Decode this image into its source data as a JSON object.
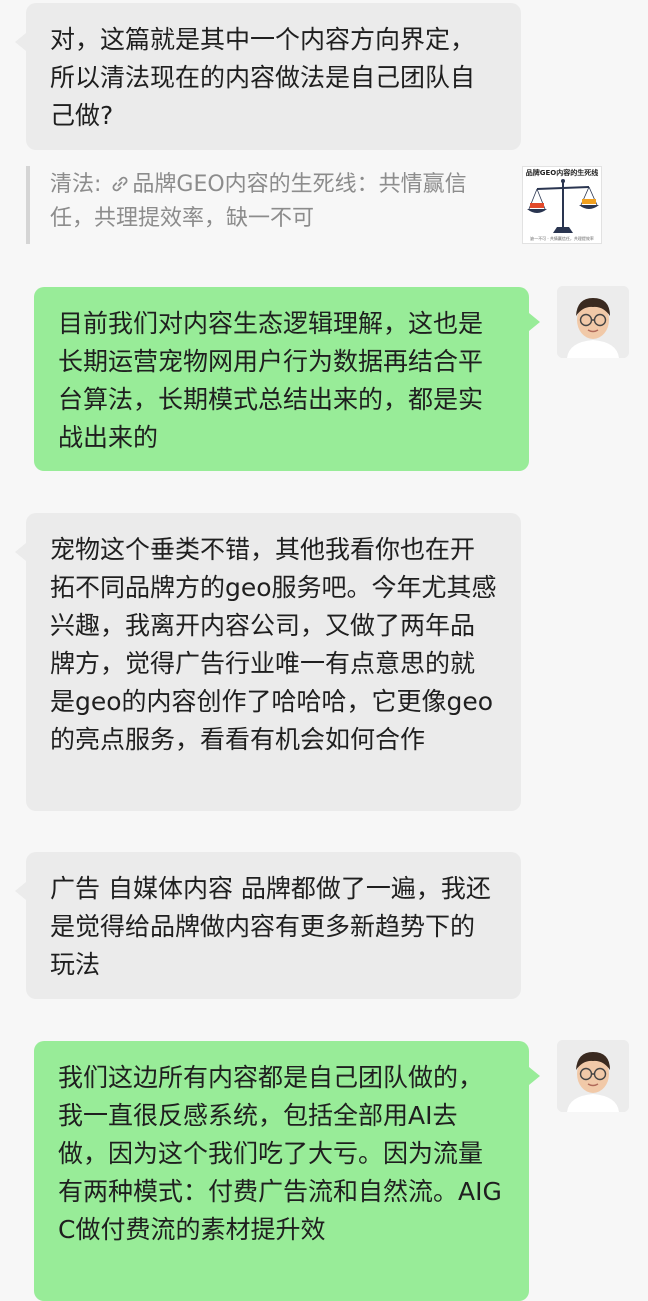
{
  "messages": [
    {
      "text": "对，这篇就是其中一个内容方向界定，所以清法现在的内容做法是自己团队自己做?"
    },
    {
      "text": "目前我们对内容生态逻辑理解，这也是长期运营宠物网用户行为数据再结合平台算法，长期模式总结出来的，都是实战出来的"
    },
    {
      "text": "宠物这个垂类不错，其他我看你也在开拓不同品牌方的geo服务吧。今年尤其感兴趣，我离开内容公司，又做了两年品牌方，觉得广告行业唯一有点意思的就是geo的内容创作了哈哈哈，它更像geo的亮点服务，看看有机会如何合作"
    },
    {
      "text": "广告  自媒体内容 品牌都做了一遍，我还是觉得给品牌做内容有更多新趋势下的玩法"
    },
    {
      "text": "我们这边所有内容都是自己团队做的，我一直很反感系统，包括全部用AI去做，因为这个我们吃了大亏。因为流量有两种模式：付费广告流和自然流。AIGC做付费流的素材提升效"
    }
  ],
  "quote": {
    "author": "清法:",
    "title": "品牌GEO内容的生死线：共情赢信任，共理提效率，缺一不可",
    "thumb_title": "品牌GEO内容的生死线",
    "thumb_caption": "缺一不可 · 共情赢信任，共理提效率",
    "link_icon": "link-icon"
  },
  "colors": {
    "background": "#f7f7f7",
    "incoming_bubble": "#ebebeb",
    "outgoing_bubble": "#98ec98"
  }
}
